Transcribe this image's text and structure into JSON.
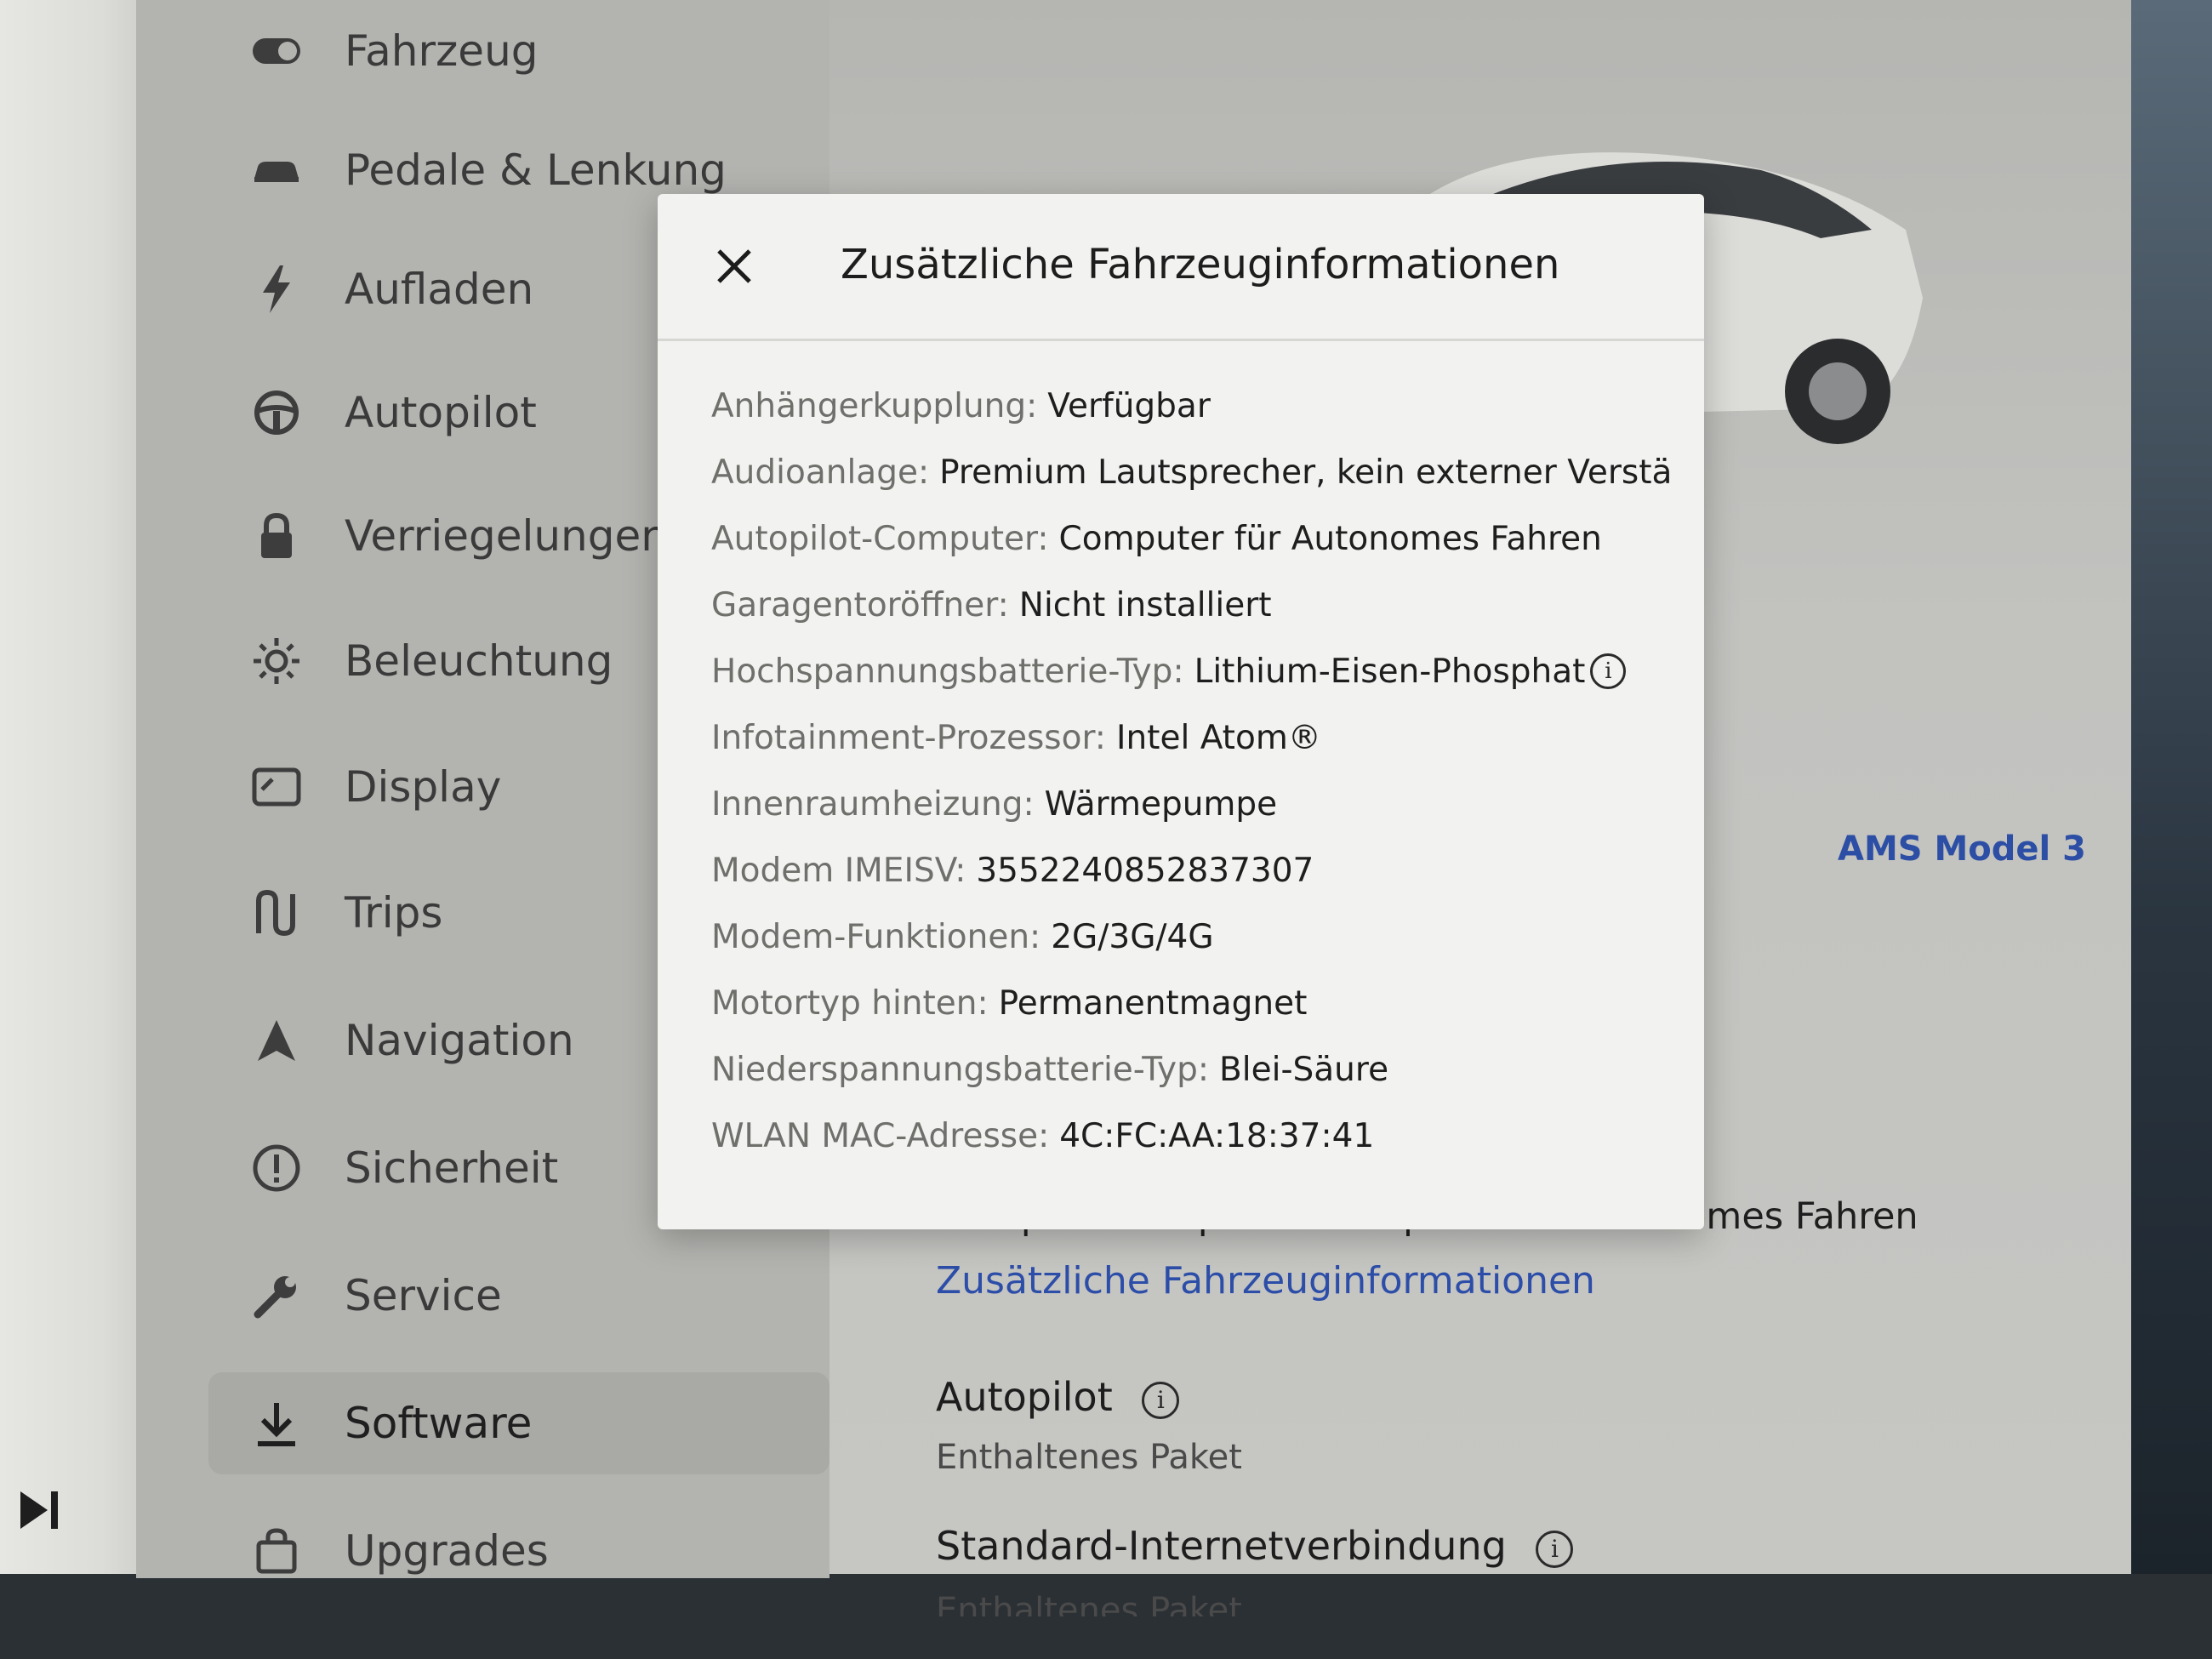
{
  "sidebar": {
    "items": [
      {
        "label": "Fahrzeug",
        "icon": "toggle-icon"
      },
      {
        "label": "Pedale & Lenkung",
        "icon": "car-icon"
      },
      {
        "label": "Aufladen",
        "icon": "lightning-icon"
      },
      {
        "label": "Autopilot",
        "icon": "steering-wheel-icon"
      },
      {
        "label": "Verriegelungen",
        "icon": "lock-icon"
      },
      {
        "label": "Beleuchtung",
        "icon": "sun-icon"
      },
      {
        "label": "Display",
        "icon": "display-icon"
      },
      {
        "label": "Trips",
        "icon": "trips-icon"
      },
      {
        "label": "Navigation",
        "icon": "navigation-arrow-icon"
      },
      {
        "label": "Sicherheit",
        "icon": "alert-circle-icon"
      },
      {
        "label": "Service",
        "icon": "wrench-icon"
      },
      {
        "label": "Software",
        "icon": "download-icon"
      },
      {
        "label": "Upgrades",
        "icon": "bag-icon"
      }
    ],
    "active": "Software"
  },
  "media": {
    "skip_icon": "skip-next-icon"
  },
  "vehicle": {
    "name": "AMS Model 3"
  },
  "background_content": {
    "autopilot_computer_line": "Autopilot-Computer: Computer für Autonomes Fahren",
    "more_info_link": "Zusätzliche Fahrzeuginformationen",
    "autopilot_title": "Autopilot",
    "autopilot_sub": "Enthaltenes Paket",
    "internet_title": "Standard-Internetverbindung",
    "internet_sub": "Enthaltenes Paket"
  },
  "modal": {
    "title": "Zusätzliche Fahrzeuginformationen",
    "close_icon": "close-icon",
    "rows": [
      {
        "key": "Anhängerkupplung:",
        "value": "Verfügbar"
      },
      {
        "key": "Audioanlage:",
        "value": "Premium Lautsprecher, kein externer Verstä"
      },
      {
        "key": "Autopilot-Computer:",
        "value": "Computer für Autonomes Fahren"
      },
      {
        "key": "Garagentoröffner:",
        "value": "Nicht installiert"
      },
      {
        "key": "Hochspannungsbatterie-Typ:",
        "value": "Lithium-Eisen-Phosphat",
        "info": "i"
      },
      {
        "key": "Infotainment-Prozessor:",
        "value": "Intel Atom®"
      },
      {
        "key": "Innenraumheizung:",
        "value": "Wärmepumpe"
      },
      {
        "key": "Modem IMEISV:",
        "value": "3552240852837307"
      },
      {
        "key": "Modem-Funktionen:",
        "value": "2G/3G/4G"
      },
      {
        "key": "Motortyp hinten:",
        "value": "Permanentmagnet"
      },
      {
        "key": "Niederspannungsbatterie-Typ:",
        "value": "Blei-Säure"
      },
      {
        "key": "WLAN MAC-Adresse:",
        "value": "4C:FC:AA:18:37:41"
      }
    ]
  },
  "info_glyph": "i",
  "colors": {
    "link": "#2d4ea8",
    "accent": "#2c4fa5"
  }
}
